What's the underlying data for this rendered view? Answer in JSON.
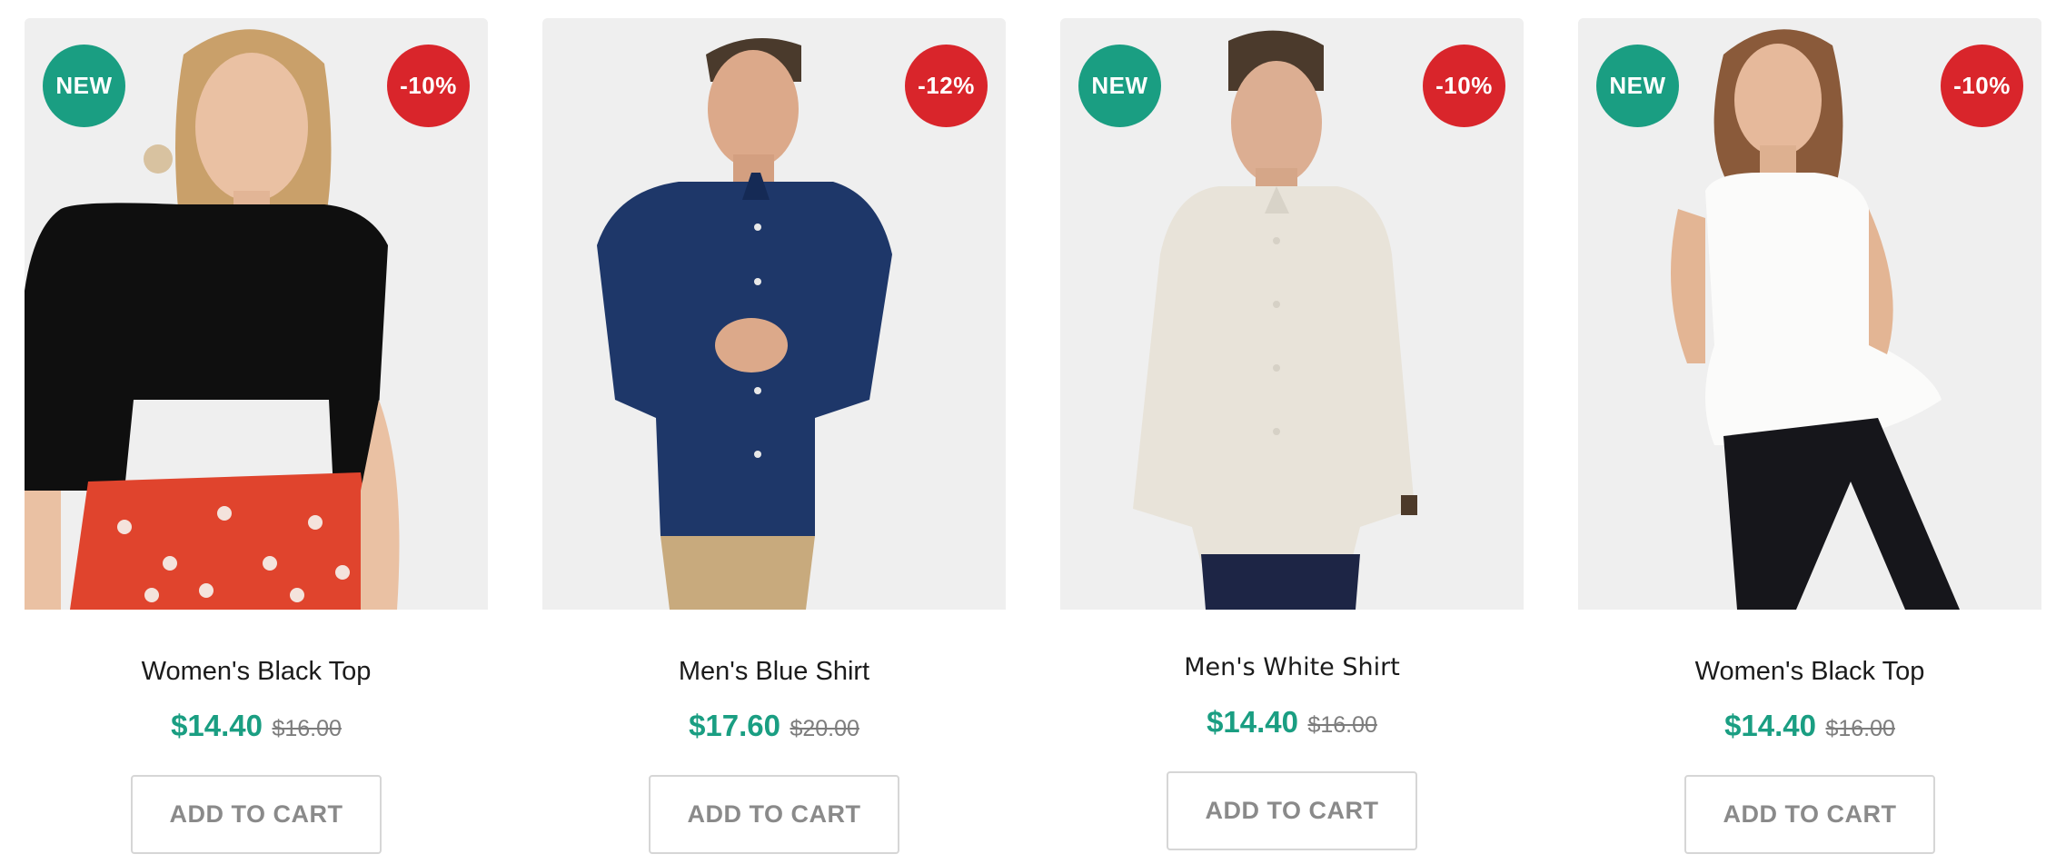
{
  "products": [
    {
      "name": "Women's Black Top",
      "price": "$14.40",
      "old_price": "$16.00",
      "badge_new": "NEW",
      "badge_discount": "-10%",
      "button": "ADD TO CART"
    },
    {
      "name": "Men's Blue Shirt",
      "price": "$17.60",
      "old_price": "$20.00",
      "badge_new": "",
      "badge_discount": "-12%",
      "button": "ADD TO CART"
    },
    {
      "name": "Men's White Shirt",
      "price": "$14.40",
      "old_price": "$16.00",
      "badge_new": "NEW",
      "badge_discount": "-10%",
      "button": "ADD TO CART"
    },
    {
      "name": "Women's Black Top",
      "price": "$14.40",
      "old_price": "$16.00",
      "badge_new": "NEW",
      "badge_discount": "-10%",
      "button": "ADD TO CART"
    }
  ],
  "colors": {
    "accent_green": "#1a9e82",
    "discount_red": "#d9252b",
    "image_bg": "#eeeeee"
  }
}
